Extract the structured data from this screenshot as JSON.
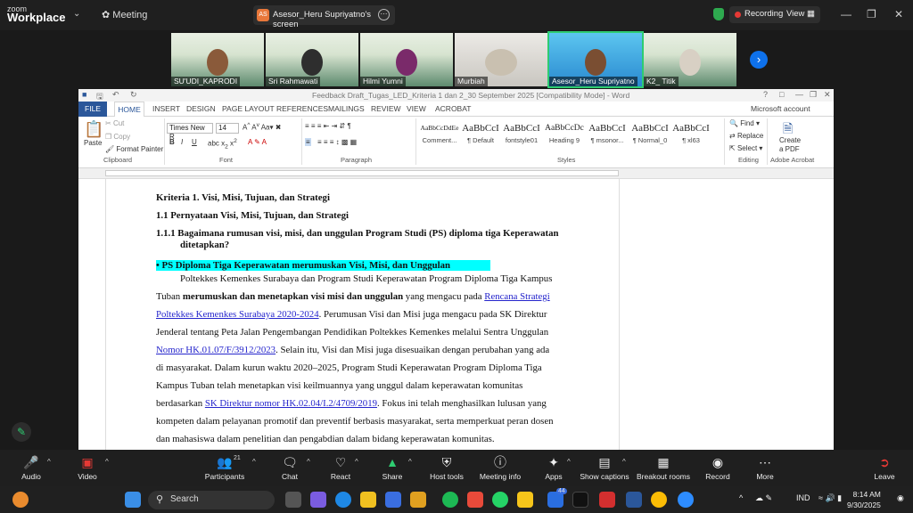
{
  "zoom": {
    "logo_line1": "zoom",
    "logo_line2": "Workplace",
    "meeting_label": "Meeting",
    "share_initials": "AS",
    "share_label": "Asesor_Heru Supriyatno's screen",
    "recording_label": "Recording",
    "view_label": "View",
    "participants_count": "21",
    "participants": [
      {
        "name": "SU'UDI_KAPRODI"
      },
      {
        "name": "Sri Rahmawati"
      },
      {
        "name": "Hilmi Yumni"
      },
      {
        "name": "Murbiah"
      },
      {
        "name": "Asesor_Heru Supriyatno"
      },
      {
        "name": "K2_ Titik"
      }
    ],
    "toolbar": {
      "audio": "Audio",
      "video": "Video",
      "participants": "Participants",
      "chat": "Chat",
      "react": "React",
      "share": "Share",
      "host_tools": "Host tools",
      "meeting_info": "Meeting info",
      "apps": "Apps",
      "show_captions": "Show captions",
      "breakout_rooms": "Breakout rooms",
      "record": "Record",
      "more": "More",
      "leave": "Leave"
    }
  },
  "word": {
    "title": "Feedback Draft_Tugas_LED_Kriteria 1 dan 2_30 September 2025 [Compatibility Mode] - Word",
    "account": "Microsoft account",
    "tabs": [
      "FILE",
      "HOME",
      "INSERT",
      "DESIGN",
      "PAGE LAYOUT",
      "REFERENCES",
      "MAILINGS",
      "REVIEW",
      "VIEW",
      "ACROBAT"
    ],
    "clipboard": {
      "paste": "Paste",
      "cut": "Cut",
      "copy": "Copy",
      "format_painter": "Format Painter",
      "group": "Clipboard"
    },
    "font": {
      "name": "Times New R",
      "size": "14",
      "group": "Font"
    },
    "paragraph_group": "Paragraph",
    "styles_group": "Styles",
    "styles": [
      {
        "preview": "AaBbCcDdEe",
        "name": "Comment..."
      },
      {
        "preview": "AaBbCcI",
        "name": "¶ Default"
      },
      {
        "preview": "AaBbCcI",
        "name": "fontstyle01"
      },
      {
        "preview": "AaBbCcDc",
        "name": "Heading 9"
      },
      {
        "preview": "AaBbCcI",
        "name": "¶ msonor..."
      },
      {
        "preview": "AaBbCcI",
        "name": "¶ Normal_0"
      },
      {
        "preview": "AaBbCcI",
        "name": "¶ xl63"
      }
    ],
    "editing": {
      "find": "Find",
      "replace": "Replace",
      "select": "Select",
      "group": "Editing"
    },
    "acrobat": {
      "create": "Create",
      "pdf": "a PDF",
      "group": "Adobe Acrobat"
    }
  },
  "doc": {
    "h1": "Kriteria 1. Visi, Misi, Tujuan, dan Strategi",
    "h2": "1.1     Pernyataan Visi, Misi, Tujuan, dan Strategi",
    "h3a": "1.1.1 Bagaimana rumusan visi, misi, dan unggulan Program Studi (PS) diploma tiga Keperawatan",
    "h3b": "ditetapkan?",
    "bullet": "•        PS Diploma Tiga Keperawatan merumuskan Visi, Misi, dan Unggulan",
    "p1": "Poltekkes Kemenkes Surabaya dan Program Studi Keperawatan Program Diploma Tiga Kampus",
    "p2a": "Tuban ",
    "p2b": "merumuskan dan menetapkan visi misi dan unggulan",
    "p2c": " yang mengacu pada ",
    "p2d": "Rencana Strategi",
    "p3a": "Poltekkes Kemenkes Surabaya 2020-2024",
    "p3b": ". Perumusan Visi dan Misi juga mengacu pada SK Direktur",
    "p4": "Jenderal tentang Peta Jalan Pengembangan Pendidikan Poltekkes Kemenkes melalui Sentra Unggulan",
    "p5a": "Nomor HK.01.07/F/3912/2023",
    "p5b": ". Selain itu, Visi dan Misi juga disesuaikan dengan perubahan yang ada",
    "p6": "di masyarakat. Dalam kurun waktu 2020–2025, Program Studi Keperawatan Program Diploma Tiga",
    "p7": "Kampus Tuban telah menetapkan visi keilmuannya yang unggul dalam keperawatan komunitas",
    "p8a": "berdasarkan ",
    "p8b": "SK Direktur nomor HK.02.04/I.2/4709/2019",
    "p8c": ". Fokus ini telah menghasilkan lulusan yang",
    "p9": "kompeten dalam pelayanan promotif dan preventif berbasis masyarakat, serta memperkuat peran dosen",
    "p10": "dan mahasiswa dalam penelitian dan pengabdian dalam bidang keperawatan komunitas."
  },
  "taskbar": {
    "search": "Search",
    "lang": "IND",
    "time": "8:14 AM",
    "date": "9/30/2025",
    "badge": "44"
  }
}
